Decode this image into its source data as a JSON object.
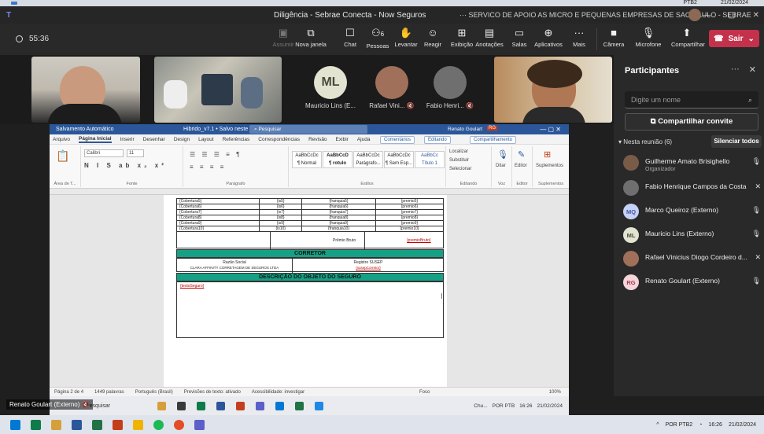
{
  "os_top": {
    "lang": "PTB2",
    "date": "21/02/2024"
  },
  "titlebar": {
    "title": "Diligência - Sebrae Conecta - Now Seguros",
    "org": "···  SERVICO DE APOIO AS MICRO E PEQUENAS EMPRESAS DE SAO PAULO - SEBRAE",
    "min": "—",
    "max": "▢",
    "close": "✕"
  },
  "toolbar": {
    "timer": "55:36",
    "buttons": [
      {
        "label": "Assumir",
        "icon": "▣"
      },
      {
        "label": "Nova janela",
        "icon": "⧉"
      },
      {
        "label": "Chat",
        "icon": "☐"
      },
      {
        "label": "Pessoas",
        "icon": "⚇",
        "badge": "6"
      },
      {
        "label": "Levantar",
        "icon": "✋"
      },
      {
        "label": "Reagir",
        "icon": "☺"
      },
      {
        "label": "Exibição",
        "icon": "⊞"
      },
      {
        "label": "Anotações",
        "icon": "▤"
      },
      {
        "label": "Salas",
        "icon": "▭"
      },
      {
        "label": "Aplicativos",
        "icon": "⊕"
      },
      {
        "label": "Mais",
        "icon": "···"
      },
      {
        "label": "Câmera",
        "icon": "■"
      },
      {
        "label": "Microfone",
        "icon": "🎙"
      },
      {
        "label": "Compartilhar",
        "icon": "⬆"
      }
    ],
    "leave": "Sair"
  },
  "tiles": [
    {
      "initials": "ML",
      "name": "Mauricio Lins (E..."
    },
    {
      "initials": "",
      "name": "Rafael Vini..."
    },
    {
      "initials": "",
      "name": "Fabio Henri..."
    }
  ],
  "word": {
    "autosave": "Salvamento Automático",
    "doc_name": "Hibrido_v7.1 • Salvo neste PC",
    "search": "Pesquisar",
    "user": "Renato Goulart",
    "user_badge": "RG",
    "menu": [
      "Arquivo",
      "Página Inicial",
      "Inserir",
      "Desenhar",
      "Design",
      "Layout",
      "Referências",
      "Correspondências",
      "Revisão",
      "Exibir",
      "Ajuda"
    ],
    "comments": "Comentários",
    "editing": "Editando",
    "share": "Compartilhamento",
    "font": "Calibri",
    "size": "11",
    "ribbon_groups": [
      "Área de T...",
      "Fonte",
      "Parágrafo",
      "Estilos",
      "Editando",
      "Voz",
      "Editor",
      "Suplementos"
    ],
    "styles": [
      {
        "sample": "AaBbCcDc",
        "name": "¶ Normal"
      },
      {
        "sample": "AaBbCcD",
        "name": "¶ rotulo"
      },
      {
        "sample": "AaBbCcDc",
        "name": "Parágrafo..."
      },
      {
        "sample": "AaBbCcDc",
        "name": "¶ Sem Esp..."
      },
      {
        "sample": "AaBbCc",
        "name": "Título 1"
      }
    ],
    "edit_items": [
      "Localizar",
      "Substituir",
      "Selecionar"
    ],
    "voice": "Ditar",
    "editor": "Editor",
    "addins": "Suplementos",
    "table_rows": [
      [
        "{Cobertura5}",
        "{is5}",
        "{franquia5}",
        "{premio5}"
      ],
      [
        "{Cobertura6}",
        "{is6}",
        "{franquia6}",
        "{premio6}"
      ],
      [
        "{Cobertura7}",
        "{is7}",
        "{franquia7}",
        "{premio7}"
      ],
      [
        "{Cobertura8}",
        "{is8}",
        "{franquia8}",
        "{premio8}"
      ],
      [
        "{Cobertura9}",
        "{is9}",
        "{franquia9}",
        "{premio9}"
      ],
      [
        "{Cobertura10}",
        "{is10}",
        "{franquia10}",
        "{premio10}"
      ]
    ],
    "premio_label": "Prêmio Bruto",
    "premio_value": "{premioBruto}",
    "corretor_header": "CORRETOR",
    "razao_label": "Razão Social",
    "razao_value": "CLARA AFFINITY CORRETAGEM DE SEGUROS LTDA",
    "susep_label": "Registro SUSEP",
    "susep_value": "{susepCorretor}",
    "descricao_header": "DESCRIÇÃO DO OBJETO DO SEGURO",
    "descricao_value": "{textoSeguro}",
    "status": [
      "Página 2 de 4",
      "1449 palavras",
      "Português (Brasil)",
      "Previsões de texto: ativado",
      "Acessibilidade: investigar"
    ],
    "focus": "Foco",
    "zoom": "100%"
  },
  "panel": {
    "title": "Participantes",
    "search_placeholder": "Digite um nome",
    "invite": "Compartilhar convite",
    "section": "Nesta reunião (6)",
    "silence": "Silenciar todos",
    "people": [
      {
        "name": "Guilherme Amato Brisighello",
        "role": "Organizador",
        "initials": "",
        "color": "#7a5b48",
        "mic": "🎙"
      },
      {
        "name": "Fabio Henrique Campos da Costa",
        "role": "",
        "initials": "",
        "color": "#6f6f6f",
        "mic": "✕"
      },
      {
        "name": "Marco Queiroz (Externo)",
        "role": "",
        "initials": "MQ",
        "color": "#c7d2f7",
        "mic": "🎙"
      },
      {
        "name": "Mauricio Lins (Externo)",
        "role": "",
        "initials": "ML",
        "color": "#e3e3d2",
        "mic": "🎙"
      },
      {
        "name": "Rafael Vinicius Diogo Cordeiro d...",
        "role": "",
        "initials": "",
        "color": "#a0705a",
        "mic": "✕"
      },
      {
        "name": "Renato Goulart (Externo)",
        "role": "",
        "initials": "RG",
        "color": "#f4d5db",
        "mic": "🎙"
      }
    ]
  },
  "nameplate": "Renato Goulart (Externo)",
  "inner_taskbar": {
    "search": "Pesquisar",
    "chat": "Chu...",
    "lang": "POR PTB",
    "time": "16:26",
    "date": "21/02/2024"
  },
  "taskbar": {
    "lang": "POR PTB2",
    "time": "16:26",
    "date": "21/02/2024"
  }
}
